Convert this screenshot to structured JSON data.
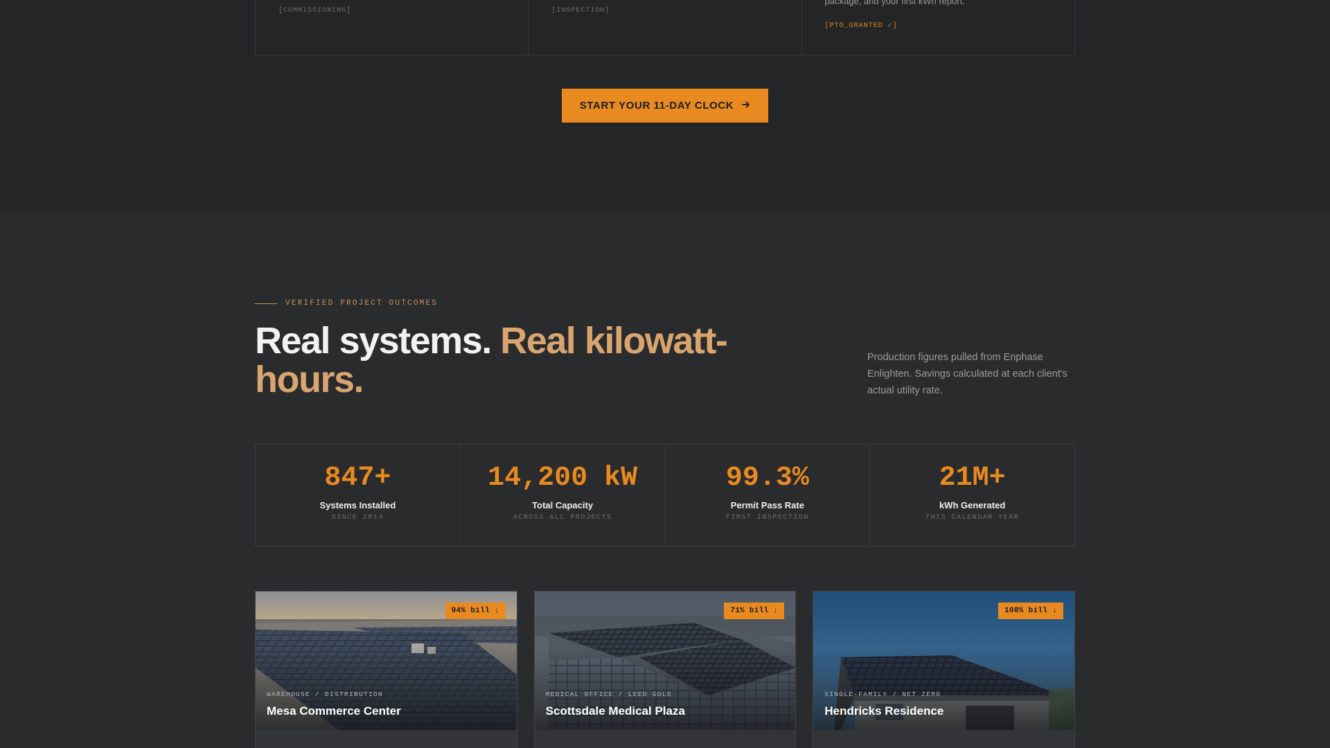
{
  "steps": [
    {
      "tag": "[COMMISSIONING]",
      "description": ""
    },
    {
      "tag": "[INSPECTION]",
      "description": ""
    },
    {
      "tag": "[PTO_GRANTED ✓]",
      "description": "package, and your first kWh report."
    }
  ],
  "cta": {
    "label": "START YOUR 11-DAY CLOCK",
    "icon": "arrow-right-icon"
  },
  "outcomes": {
    "eyebrow": "VERIFIED PROJECT OUTCOMES",
    "headline_main": "Real systems.",
    "headline_accent": "Real kilowatt-hours.",
    "side_note": "Production figures pulled from Enphase Enlighten. Savings calculated at each client's actual utility rate."
  },
  "stats": [
    {
      "value": "847+",
      "label": "Systems Installed",
      "sub": "SINCE 2014"
    },
    {
      "value": "14,200 kW",
      "label": "Total Capacity",
      "sub": "ACROSS ALL PROJECTS"
    },
    {
      "value": "99.3%",
      "label": "Permit Pass Rate",
      "sub": "FIRST INSPECTION"
    },
    {
      "value": "21M+",
      "label": "kWh Generated",
      "sub": "THIS CALENDAR YEAR"
    }
  ],
  "projects": [
    {
      "badge": "94% bill ↓",
      "category": "WAREHOUSE / DISTRIBUTION",
      "title": "Mesa Commerce Center"
    },
    {
      "badge": "71% bill ↓",
      "category": "MEDICAL OFFICE / LEED GOLD",
      "title": "Scottsdale Medical Plaza"
    },
    {
      "badge": "108% bill ↓",
      "category": "SINGLE-FAMILY / NET ZERO",
      "title": "Hendricks Residence"
    }
  ],
  "colors": {
    "accent": "#e88a1f",
    "accent_soft": "#d9a56f",
    "bg_dark": "#242527",
    "bg": "#2a2b2d"
  }
}
